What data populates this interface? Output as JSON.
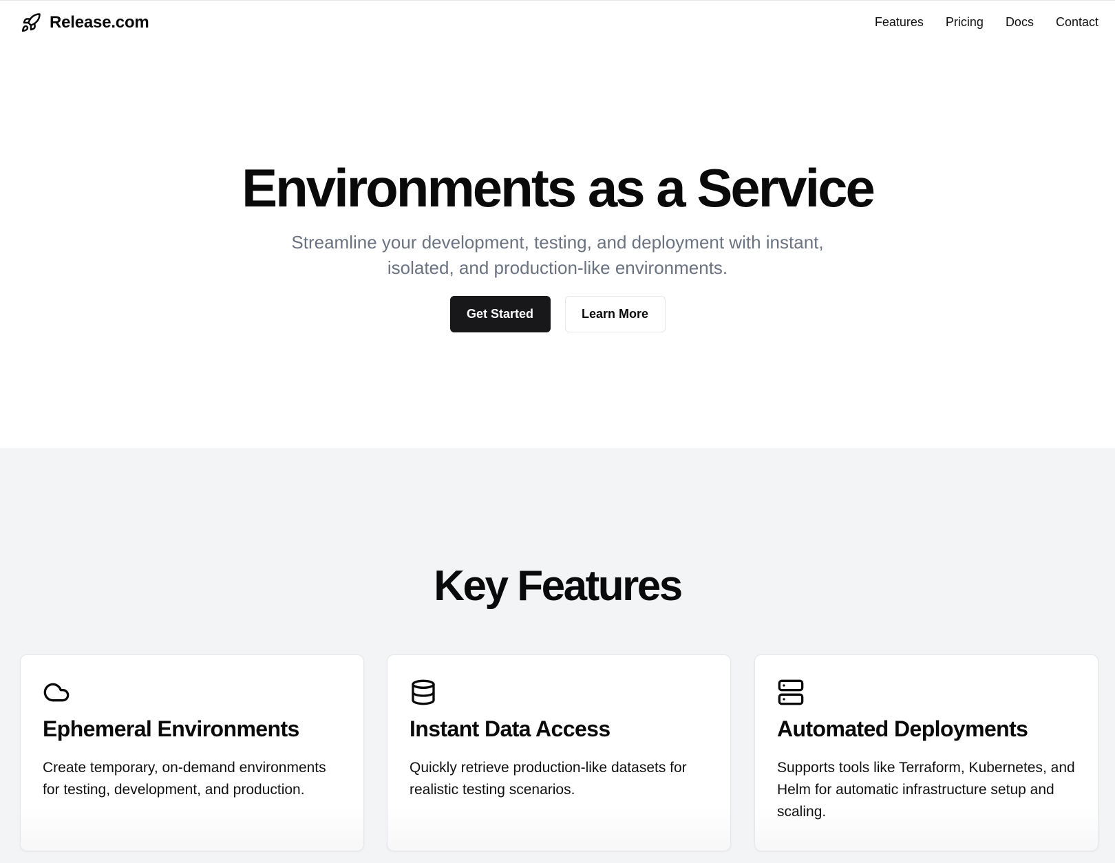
{
  "header": {
    "brand": "Release.com",
    "brand_icon": "rocket-icon",
    "nav": [
      {
        "label": "Features"
      },
      {
        "label": "Pricing"
      },
      {
        "label": "Docs"
      },
      {
        "label": "Contact"
      }
    ]
  },
  "hero": {
    "title": "Environments as a Service",
    "subtitle": "Streamline your development, testing, and deployment with instant, isolated, and production-like environments.",
    "primary_cta": "Get Started",
    "secondary_cta": "Learn More"
  },
  "features": {
    "title": "Key Features",
    "cards": [
      {
        "icon": "cloud-icon",
        "title": "Ephemeral Environments",
        "text": "Create temporary, on-demand environments for testing, development, and production."
      },
      {
        "icon": "database-icon",
        "title": "Instant Data Access",
        "text": "Quickly retrieve production-like datasets for realistic testing scenarios."
      },
      {
        "icon": "server-icon",
        "title": "Automated Deployments",
        "text": "Supports tools like Terraform, Kubernetes, and Helm for automatic infrastructure setup and scaling."
      }
    ]
  },
  "colors": {
    "text": "#0a0a0a",
    "muted": "#6b7280",
    "primary_button": "#18181b",
    "section_bg": "#f3f4f6",
    "border": "#e5e7eb"
  }
}
